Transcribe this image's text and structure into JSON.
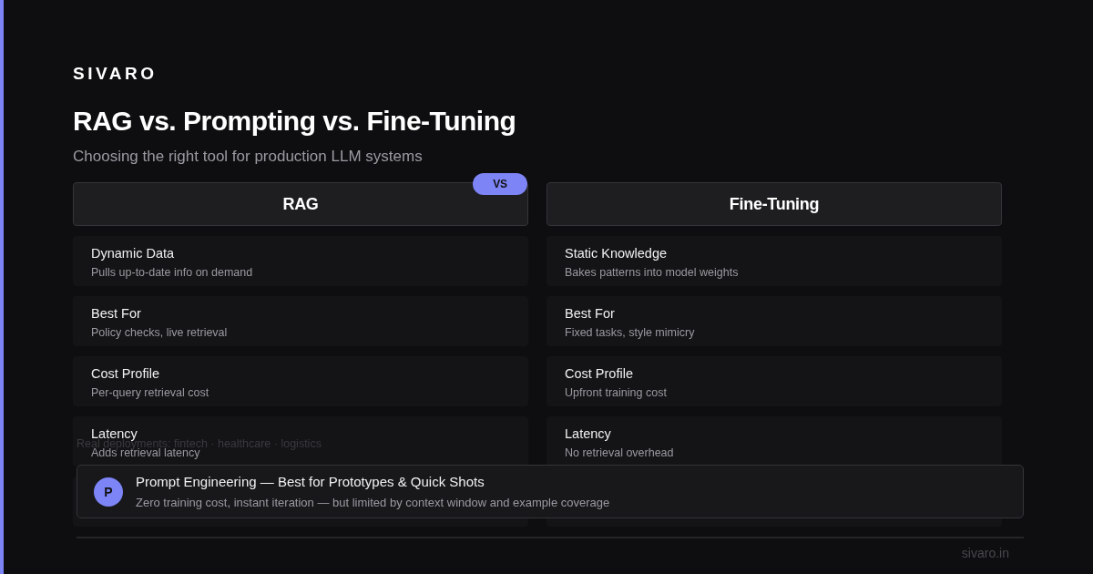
{
  "brand": "SIVARO",
  "title": "RAG vs. Prompting vs. Fine-Tuning",
  "subtitle": "Choosing the right tool for production LLM systems",
  "vs_badge": "VS",
  "columns": [
    {
      "heading": "RAG",
      "rows": [
        {
          "title": "Dynamic Data",
          "description": "Pulls up-to-date info on demand"
        },
        {
          "title": "Best For",
          "description": "Policy checks, live retrieval"
        },
        {
          "title": "Cost Profile",
          "description": "Per-query retrieval cost"
        },
        {
          "title": "Latency",
          "description": "Adds retrieval latency"
        }
      ]
    },
    {
      "heading": "Fine-Tuning",
      "rows": [
        {
          "title": "Static Knowledge",
          "description": "Bakes patterns into model weights"
        },
        {
          "title": "Best For",
          "description": "Fixed tasks, style mimicry"
        },
        {
          "title": "Cost Profile",
          "description": "Upfront training cost"
        },
        {
          "title": "Latency",
          "description": "No retrieval overhead"
        }
      ]
    }
  ],
  "deployments_note": "Real deployments: fintech · healthcare · logistics",
  "callout": {
    "avatar": "P",
    "title": "Prompt Engineering — Best for Prototypes & Quick Shots",
    "description": "Zero training cost, instant iteration — but limited by context window and example coverage"
  },
  "footer": "sivaro.in"
}
